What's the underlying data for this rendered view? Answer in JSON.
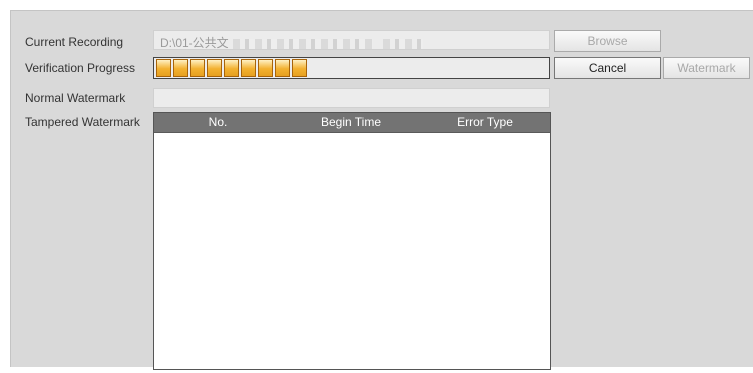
{
  "labels": {
    "current_recording": "Current Recording",
    "verification_progress": "Verification Progress",
    "normal_watermark": "Normal Watermark",
    "tampered_watermark": "Tampered Watermark"
  },
  "current_recording_path": "D:\\01-公共文",
  "progress": {
    "filled_segments": 9,
    "value_fraction": 0.42
  },
  "normal_watermark_value": "",
  "buttons": {
    "browse": "Browse",
    "cancel": "Cancel",
    "watermark": "Watermark"
  },
  "table": {
    "columns": [
      "No.",
      "Begin Time",
      "Error Type"
    ],
    "rows": []
  },
  "colors": {
    "progress_fill": "#f3b130",
    "table_header": "#737373",
    "panel": "#d9d9d9"
  }
}
